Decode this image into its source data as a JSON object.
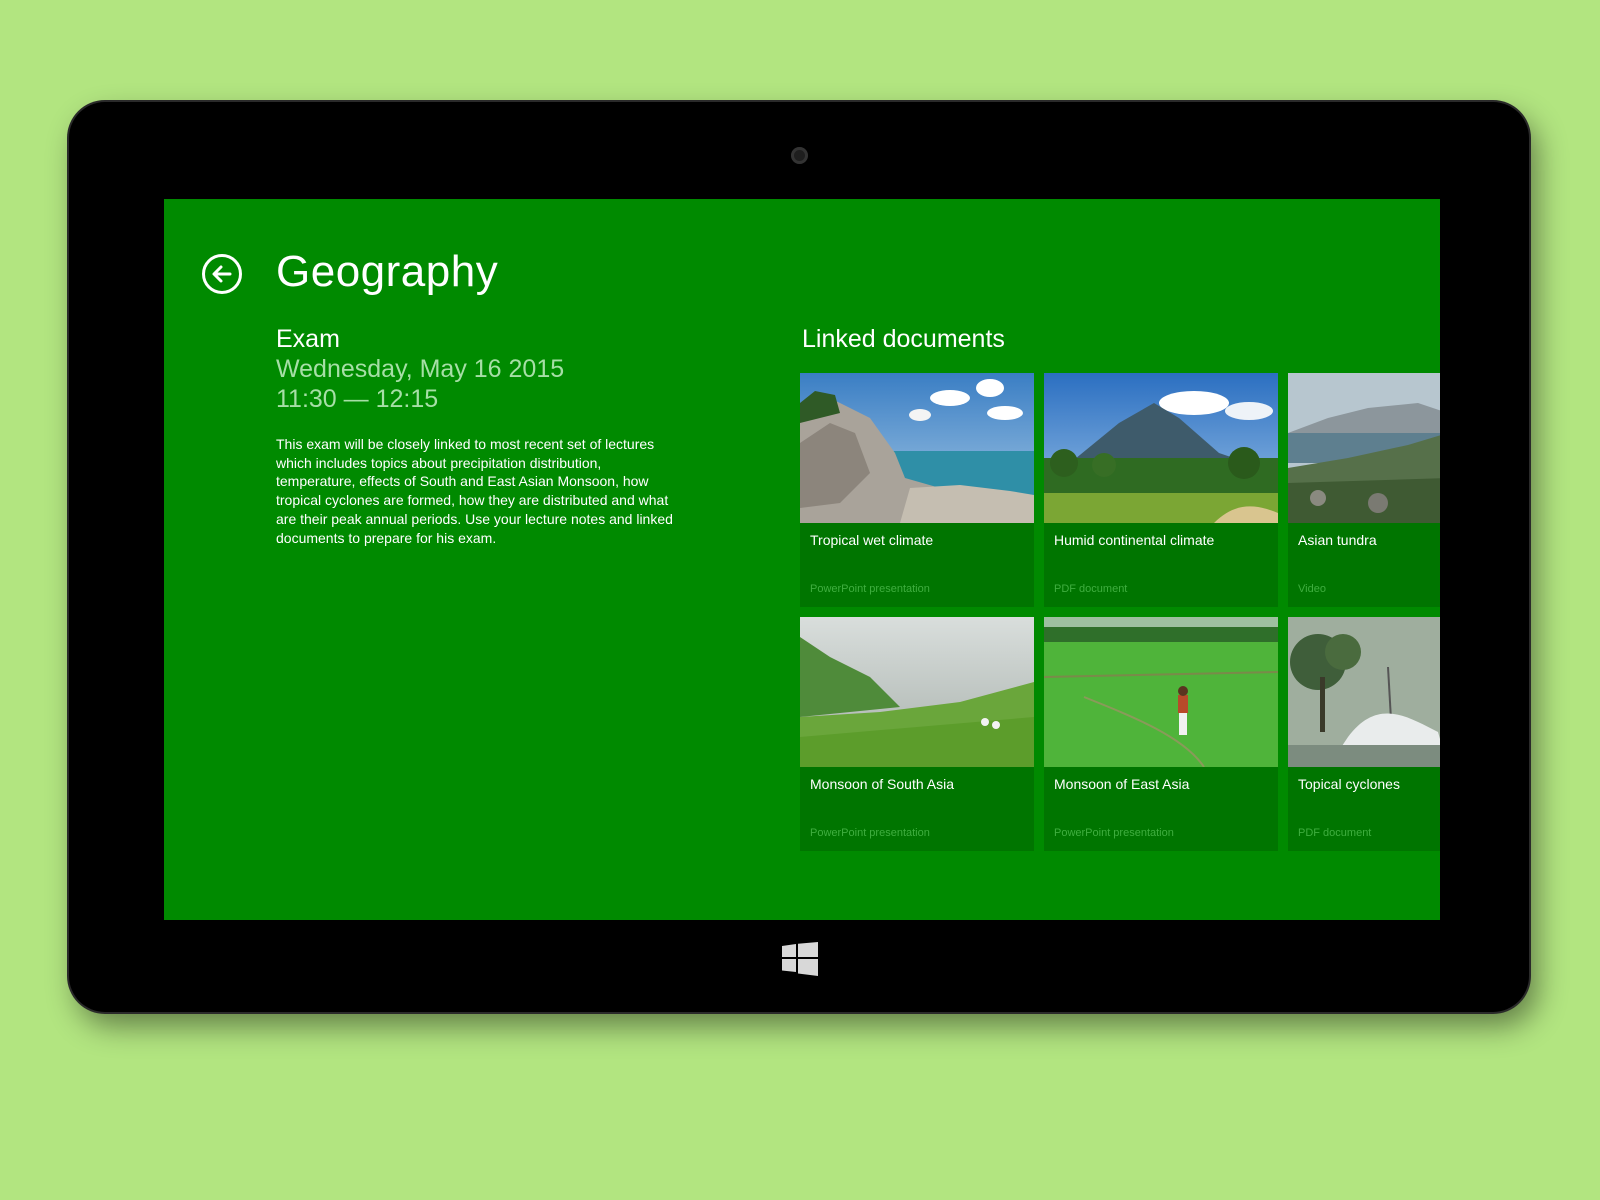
{
  "page": {
    "title": "Geography"
  },
  "exam": {
    "label": "Exam",
    "date": "Wednesday, May 16 2015",
    "time": "11:30 — 12:15",
    "description": "This exam will be closely linked to most recent set of lectures which includes topics about precipitation distribution, temperature, effects of South and East Asian Monsoon, how tropical cyclones are formed, how they are distributed and what are their peak annual periods. Use your lecture notes and linked documents to prepare for his exam."
  },
  "linked_documents": {
    "title": "Linked documents",
    "items": [
      {
        "title": "Tropical wet climate",
        "type": "PowerPoint presentation",
        "thumbnail": "rocky-coast-image"
      },
      {
        "title": "Humid continental climate",
        "type": "PDF document",
        "thumbnail": "volcano-landscape-image"
      },
      {
        "title": "Asian tundra",
        "type": "Video",
        "thumbnail": "coastal-cliffs-image"
      },
      {
        "title": "Monsoon of South Asia",
        "type": "PowerPoint presentation",
        "thumbnail": "misty-hills-image"
      },
      {
        "title": "Monsoon of East Asia",
        "type": "PowerPoint presentation",
        "thumbnail": "rice-field-image"
      },
      {
        "title": "Topical cyclones",
        "type": "PDF document",
        "thumbnail": "storm-waves-image"
      }
    ]
  },
  "colors": {
    "background": "#b2e580",
    "screen": "#008a00",
    "tile": "#007500",
    "secondary_text": "#a6dfa6",
    "tile_type_text": "#3fae3f"
  },
  "icons": {
    "back": "back-arrow-icon",
    "windows": "windows-logo-icon",
    "camera": "camera-icon"
  }
}
